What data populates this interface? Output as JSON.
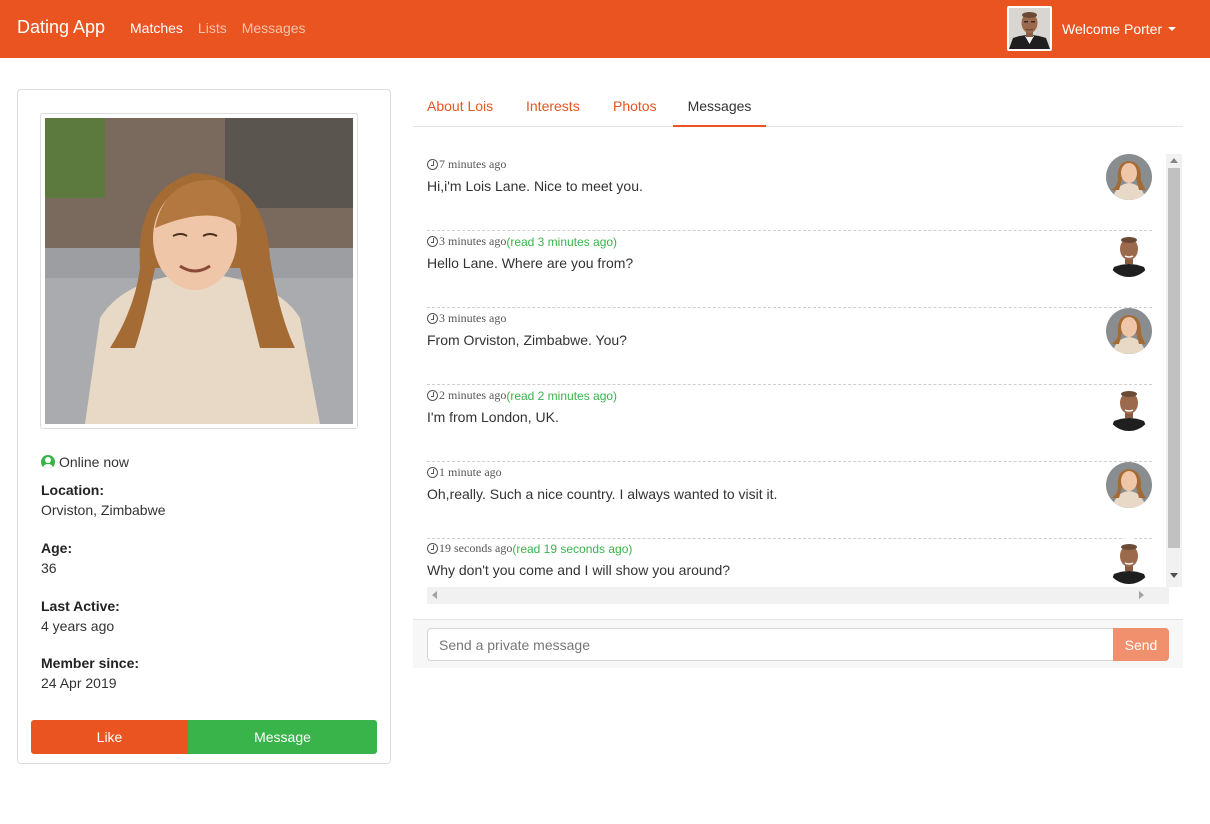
{
  "navbar": {
    "brand": "Dating App",
    "links": [
      "Matches",
      "Lists",
      "Messages"
    ],
    "active_link": "Matches",
    "welcome": "Welcome Porter",
    "accent": "#e95420"
  },
  "profile": {
    "online_text": "Online now",
    "location_label": "Location:",
    "location": "Orviston, Zimbabwe",
    "age_label": "Age:",
    "age": "36",
    "last_active_label": "Last Active:",
    "last_active": "4 years ago",
    "member_since_label": "Member since:",
    "member_since": "24 Apr 2019",
    "like_label": "Like",
    "message_label": "Message",
    "like_color": "#e95420",
    "message_color": "#38b44a"
  },
  "tabs": [
    {
      "label": "About Lois",
      "active": false
    },
    {
      "label": "Interests",
      "active": false
    },
    {
      "label": "Photos",
      "active": false
    },
    {
      "label": "Messages",
      "active": true
    }
  ],
  "messages": [
    {
      "time": "7 minutes ago",
      "read": "",
      "text": "Hi,i'm Lois Lane. Nice to meet you.",
      "sender": "lois"
    },
    {
      "time": "3 minutes ago",
      "read": "(read 3 minutes ago)",
      "text": "Hello Lane. Where are you from?",
      "sender": "porter"
    },
    {
      "time": "3 minutes ago",
      "read": "",
      "text": "From Orviston, Zimbabwe. You?",
      "sender": "lois"
    },
    {
      "time": "2 minutes ago",
      "read": "(read 2 minutes ago)",
      "text": "I'm from London, UK.",
      "sender": "porter"
    },
    {
      "time": "1 minute ago",
      "read": "",
      "text": "Oh,really. Such a nice country. I always wanted to visit it.",
      "sender": "lois"
    },
    {
      "time": "19 seconds ago",
      "read": "(read 19 seconds ago)",
      "text": "Why don't you come and I will show you around?",
      "sender": "porter"
    }
  ],
  "composer": {
    "placeholder": "Send a private message",
    "send_label": "Send"
  }
}
